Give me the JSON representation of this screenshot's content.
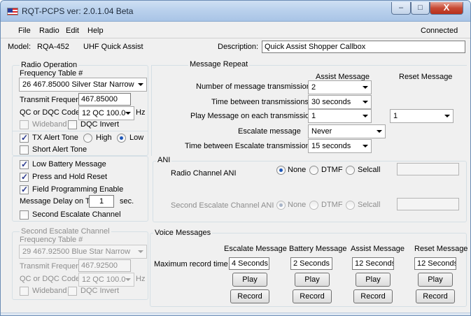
{
  "window": {
    "title": "RQT-PCPS ver: 2.0.1.04 Beta",
    "minimize": "‒",
    "maximize": "□",
    "close": "X"
  },
  "menu": {
    "file": "File",
    "radio": "Radio",
    "edit": "Edit",
    "help": "Help",
    "status": "Connected"
  },
  "header": {
    "model_label": "Model:",
    "model_value": "RQA-452",
    "band": "UHF Quick Assist",
    "description_label": "Description:",
    "description_value": "Quick Assist Shopper Callbox"
  },
  "radio_operation": {
    "title": "Radio Operation",
    "freq_table_label": "Frequency Table #",
    "freq_table_value": "26  467.85000  Silver Star Narrow",
    "tx_freq_label": "Transmit Frequency",
    "tx_freq_value": "467.85000",
    "qc_label": "QC or DQC Code:",
    "qc_value": "12 QC 100.0",
    "hz": "Hz",
    "wideband": "Wideband",
    "dqc_invert": "DQC Invert"
  },
  "tx_alert": {
    "label": "TX Alert Tone",
    "high": "High",
    "low": "Low",
    "short": "Short Alert Tone"
  },
  "options": {
    "low_battery": "Low Battery Message",
    "press_hold": "Press and Hold Reset",
    "field_prog": "Field Programming Enable",
    "delay_label": "Message Delay on TX",
    "delay_value": "1",
    "delay_unit": "sec.",
    "second_escalate": "Second Escalate Channel"
  },
  "second_escalate": {
    "title": "Second Escalate Channel",
    "freq_table_label": "Frequency Table #",
    "freq_table_value": "29  467.92500  Blue Star Narrow",
    "tx_freq_label": "Transmit Frequency",
    "tx_freq_value": "467.92500",
    "qc_label": "QC or DQC Code:",
    "qc_value": "12 QC 100.0",
    "hz": "Hz",
    "wideband": "Wideband",
    "dqc_invert": "DQC Invert"
  },
  "message_repeat": {
    "title": "Message Repeat",
    "assist_header": "Assist Message",
    "reset_header": "Reset Message",
    "num_tx_label": "Number of message transmissions",
    "num_tx_value": "2",
    "time_between_label": "Time between transmissions",
    "time_between_value": "30 seconds",
    "play_each_label": "Play Message on each transmission",
    "play_each_assist": "1",
    "play_each_reset": "1",
    "escalate_label": "Escalate message",
    "escalate_value": "Never",
    "escalate_time_label": "Time between Escalate transmissions",
    "escalate_time_value": "15 seconds"
  },
  "ani": {
    "title": "ANI",
    "channel_label": "Radio Channel ANI",
    "second_label": "Second Escalate Channel ANI",
    "none": "None",
    "dtmf": "DTMF",
    "selcall": "Selcall"
  },
  "voice": {
    "title": "Voice Messages",
    "max_label": "Maximum record time",
    "play": "Play",
    "record": "Record",
    "columns": [
      {
        "header": "Escalate Message",
        "time": "4 Seconds"
      },
      {
        "header": "Battery Message",
        "time": "2 Seconds"
      },
      {
        "header": "Assist Message",
        "time": "12 Seconds"
      },
      {
        "header": "Reset Message",
        "time": "12 Seconds"
      }
    ]
  }
}
